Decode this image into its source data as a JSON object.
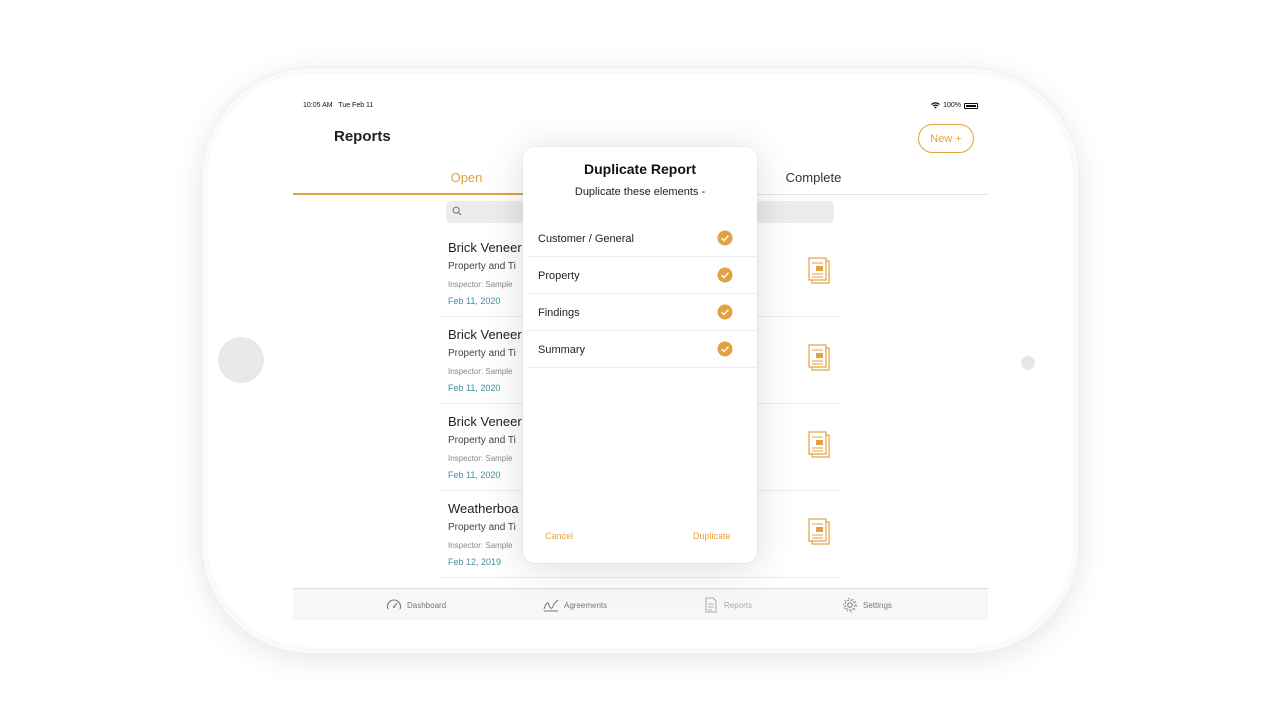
{
  "status_bar": {
    "time": "10:05 AM",
    "date": "Tue Feb 11",
    "battery": "100%"
  },
  "header": {
    "title": "Reports",
    "new_button": "New +"
  },
  "tabs": [
    {
      "label": "Open",
      "active": true
    },
    {
      "label": "Complete",
      "active": false
    }
  ],
  "reports": [
    {
      "title": "Brick Veneer",
      "subtitle": "Property and Ti",
      "inspector": "Inspector: Sample",
      "date": "Feb 11, 2020"
    },
    {
      "title": "Brick Veneer",
      "subtitle": "Property and Ti",
      "inspector": "Inspector: Sample",
      "date": "Feb 11, 2020"
    },
    {
      "title": "Brick Veneer",
      "subtitle": "Property and Ti",
      "inspector": "Inspector: Sample",
      "date": "Feb 11, 2020"
    },
    {
      "title": "Weatherboa",
      "subtitle": "Property and Ti",
      "inspector": "Inspector: Sample",
      "date": "Feb 12, 2019"
    }
  ],
  "tab_bar": {
    "dashboard": "Dashboard",
    "agreements": "Agreements",
    "reports": "Reports",
    "settings": "Settings"
  },
  "dialog": {
    "title": "Duplicate Report",
    "subtitle": "Duplicate these elements -",
    "options": [
      {
        "label": "Customer / General",
        "checked": true
      },
      {
        "label": "Property",
        "checked": true
      },
      {
        "label": "Findings",
        "checked": true
      },
      {
        "label": "Summary",
        "checked": true
      }
    ],
    "cancel": "Cancel",
    "confirm": "Duplicate"
  },
  "colors": {
    "accent": "#e0a243",
    "date": "#3e8fa6"
  },
  "icons": [
    "search-icon",
    "report-document-icon",
    "checkmark-icon",
    "dashboard-gauge-icon",
    "agreements-signature-icon",
    "reports-document-icon",
    "settings-gear-icon",
    "wifi-icon",
    "battery-icon"
  ]
}
